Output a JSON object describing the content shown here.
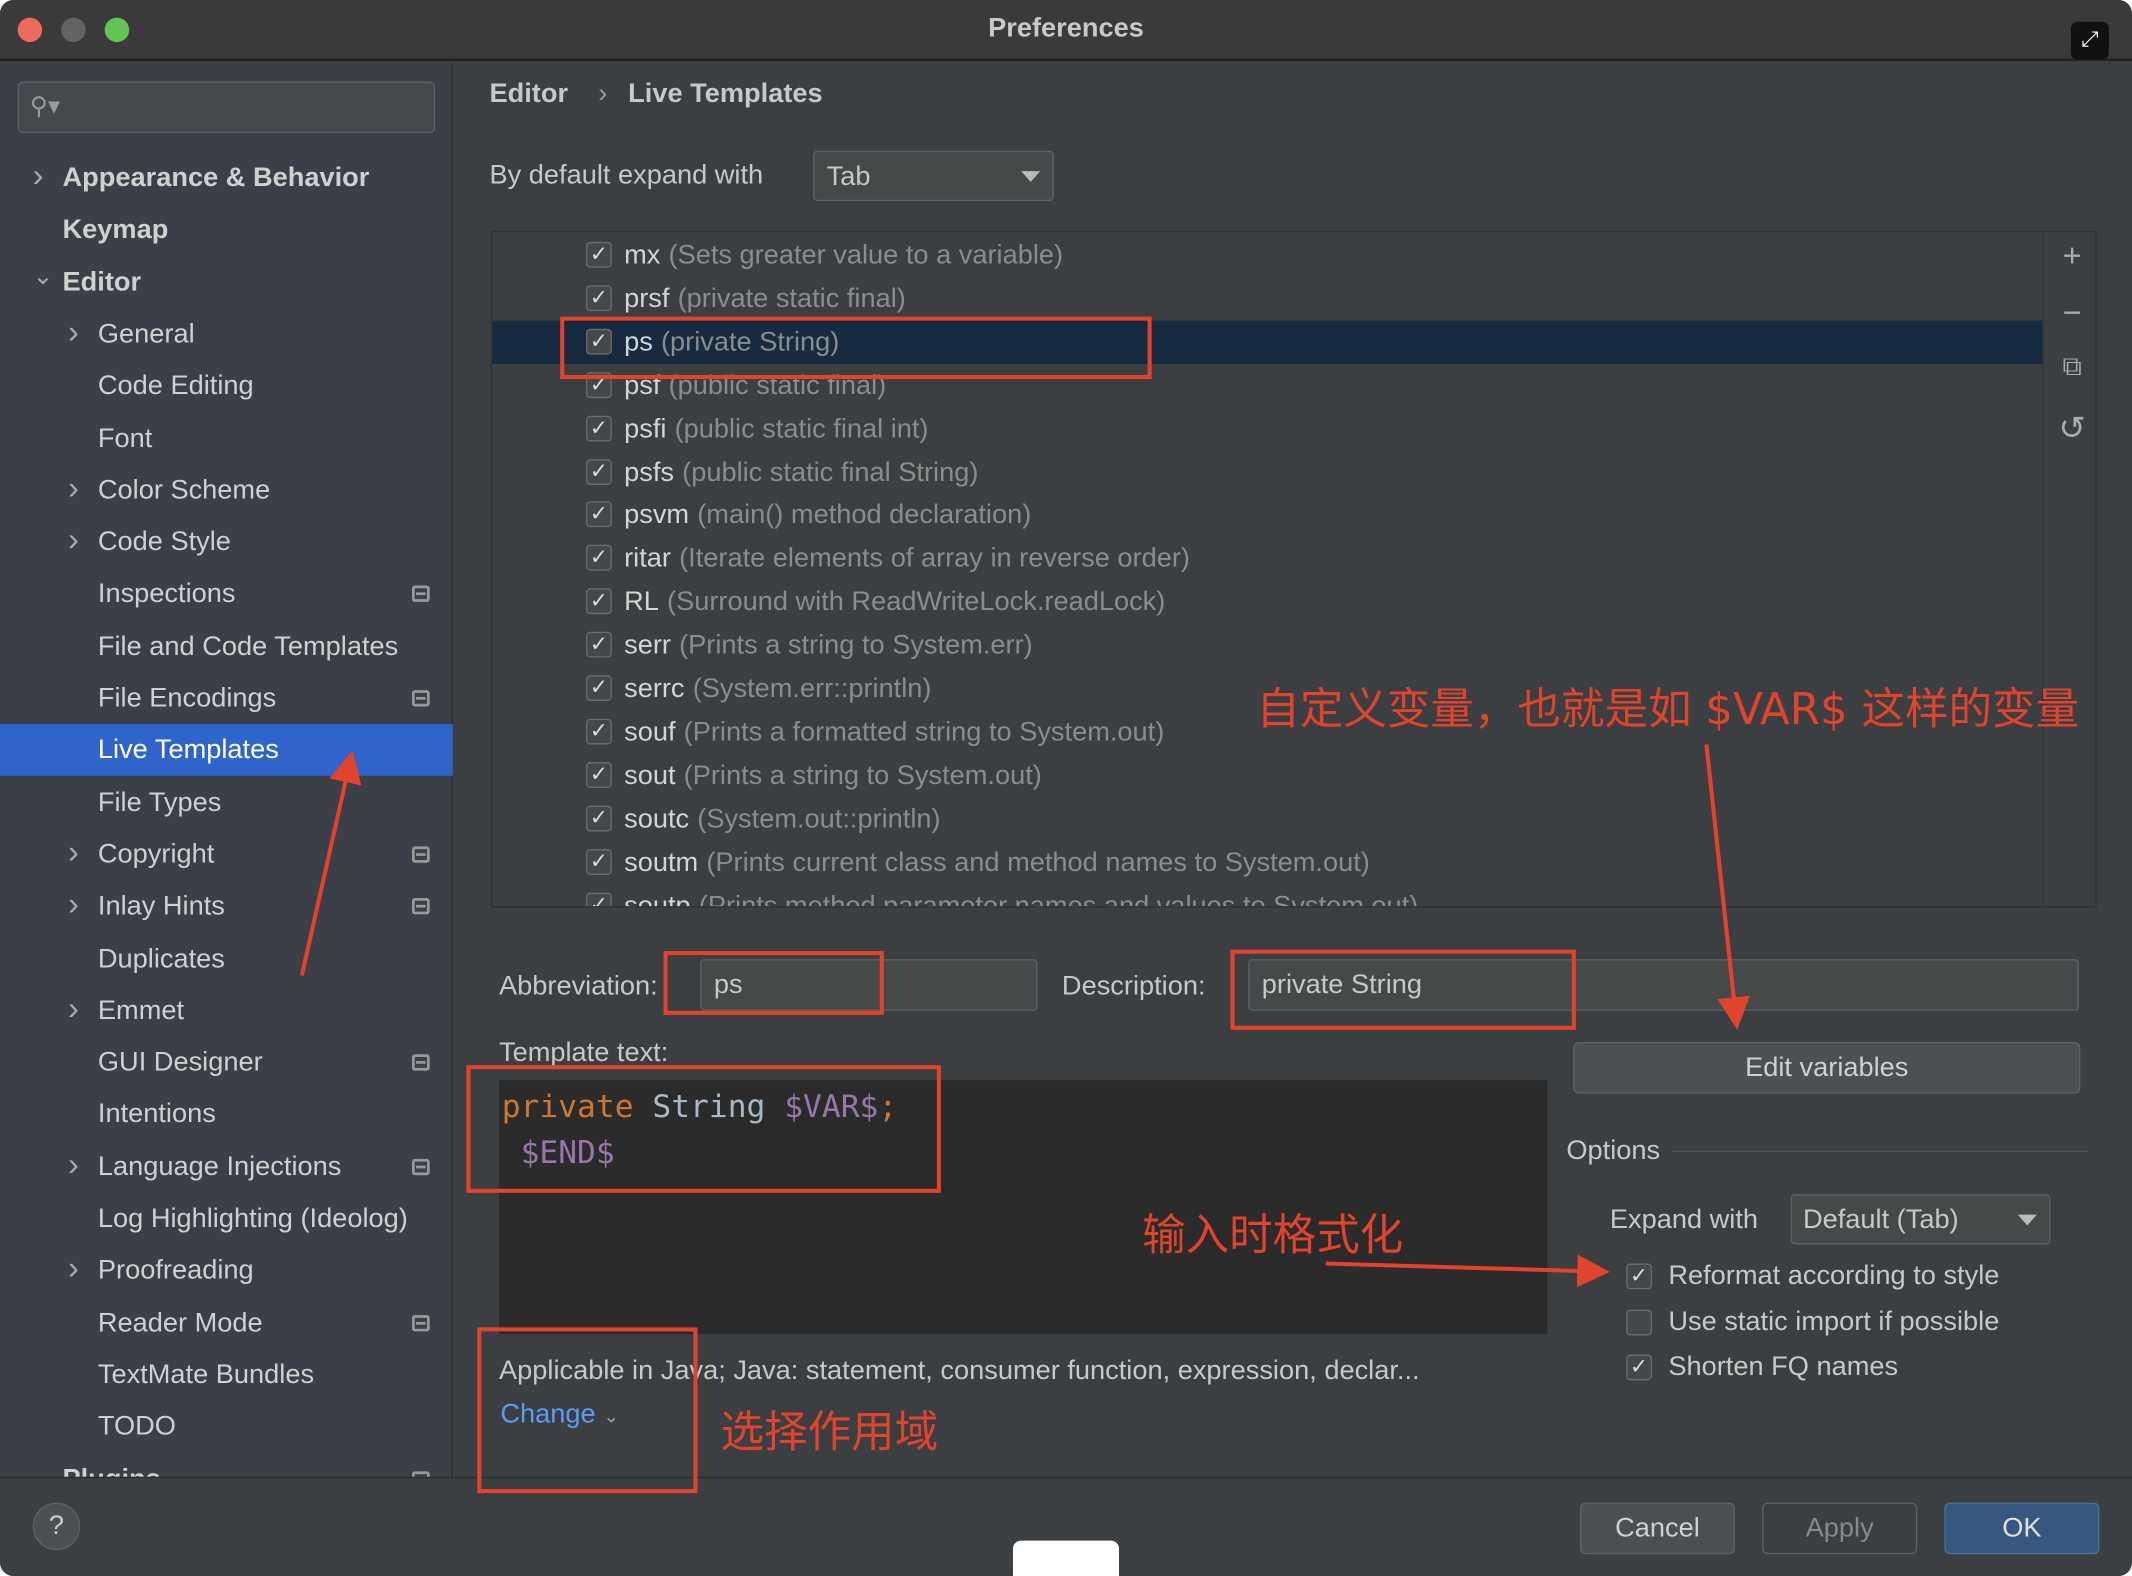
{
  "window": {
    "title": "Preferences"
  },
  "sidebar": {
    "search_placeholder": "",
    "items": [
      {
        "label": "Appearance & Behavior",
        "level": 0,
        "chevron": "right",
        "bold": true
      },
      {
        "label": "Keymap",
        "level": 0,
        "bold": true
      },
      {
        "label": "Editor",
        "level": 0,
        "chevron": "down",
        "bold": true
      },
      {
        "label": "General",
        "level": 1,
        "chevron": "right"
      },
      {
        "label": "Code Editing",
        "level": 1
      },
      {
        "label": "Font",
        "level": 1
      },
      {
        "label": "Color Scheme",
        "level": 1,
        "chevron": "right"
      },
      {
        "label": "Code Style",
        "level": 1,
        "chevron": "right"
      },
      {
        "label": "Inspections",
        "level": 1,
        "settings": true
      },
      {
        "label": "File and Code Templates",
        "level": 1
      },
      {
        "label": "File Encodings",
        "level": 1,
        "settings": true
      },
      {
        "label": "Live Templates",
        "level": 1,
        "selected": true
      },
      {
        "label": "File Types",
        "level": 1
      },
      {
        "label": "Copyright",
        "level": 1,
        "chevron": "right",
        "settings": true
      },
      {
        "label": "Inlay Hints",
        "level": 1,
        "chevron": "right",
        "settings": true
      },
      {
        "label": "Duplicates",
        "level": 1
      },
      {
        "label": "Emmet",
        "level": 1,
        "chevron": "right"
      },
      {
        "label": "GUI Designer",
        "level": 1,
        "settings": true
      },
      {
        "label": "Intentions",
        "level": 1
      },
      {
        "label": "Language Injections",
        "level": 1,
        "chevron": "right",
        "settings": true
      },
      {
        "label": "Log Highlighting (Ideolog)",
        "level": 1
      },
      {
        "label": "Proofreading",
        "level": 1,
        "chevron": "right"
      },
      {
        "label": "Reader Mode",
        "level": 1,
        "settings": true
      },
      {
        "label": "TextMate Bundles",
        "level": 1
      },
      {
        "label": "TODO",
        "level": 1
      },
      {
        "label": "Plugins",
        "level": 0,
        "bold": true,
        "settings": true
      }
    ]
  },
  "breadcrumb": {
    "parent": "Editor",
    "separator": "›",
    "current": "Live Templates"
  },
  "expand": {
    "label": "By default expand with",
    "value": "Tab"
  },
  "templates": [
    {
      "abbr": "mx",
      "desc": "(Sets greater value to a variable)",
      "checked": true
    },
    {
      "abbr": "prsf",
      "desc": "(private static final)",
      "checked": true
    },
    {
      "abbr": "ps",
      "desc": "(private String)",
      "checked": true,
      "selected": true
    },
    {
      "abbr": "psf",
      "desc": "(public static final)",
      "checked": true
    },
    {
      "abbr": "psfi",
      "desc": "(public static final int)",
      "checked": true
    },
    {
      "abbr": "psfs",
      "desc": "(public static final String)",
      "checked": true
    },
    {
      "abbr": "psvm",
      "desc": "(main() method declaration)",
      "checked": true
    },
    {
      "abbr": "ritar",
      "desc": "(Iterate elements of array in reverse order)",
      "checked": true
    },
    {
      "abbr": "RL",
      "desc": "(Surround with ReadWriteLock.readLock)",
      "checked": true
    },
    {
      "abbr": "serr",
      "desc": "(Prints a string to System.err)",
      "checked": true
    },
    {
      "abbr": "serrc",
      "desc": "(System.err::println)",
      "checked": true
    },
    {
      "abbr": "souf",
      "desc": "(Prints a formatted string to System.out)",
      "checked": true
    },
    {
      "abbr": "sout",
      "desc": "(Prints a string to System.out)",
      "checked": true
    },
    {
      "abbr": "soutc",
      "desc": "(System.out::println)",
      "checked": true
    },
    {
      "abbr": "soutm",
      "desc": "(Prints current class and method names to System.out)",
      "checked": true
    },
    {
      "abbr": "soutp",
      "desc": "(Prints method parameter names and values to System.out)",
      "checked": true
    }
  ],
  "tools": {
    "add": "+",
    "remove": "−",
    "copy": "⧉",
    "restore": "↺"
  },
  "detail": {
    "abbreviation_label": "Abbreviation:",
    "abbreviation": "ps",
    "description_label": "Description:",
    "description": "private String",
    "template_text_label": "Template text:",
    "code": {
      "kw": "private",
      "type": "String",
      "var": "$VAR$",
      "semi": ";",
      "end": "$END$"
    },
    "edit_variables": "Edit variables",
    "applicable": "Applicable in Java; Java: statement, consumer function, expression, declar...",
    "change": "Change"
  },
  "options": {
    "title": "Options",
    "expand_label": "Expand with",
    "expand_value": "Default (Tab)",
    "checks": [
      {
        "label": "Reformat according to style",
        "checked": true
      },
      {
        "label": "Use static import if possible",
        "checked": false
      },
      {
        "label": "Shorten FQ names",
        "checked": true
      }
    ]
  },
  "annotations": {
    "variables": "自定义变量，也就是如 $VAR$ 这样的变量",
    "reformat": "输入时格式化",
    "scope": "选择作用域"
  },
  "footer": {
    "help": "?",
    "cancel": "Cancel",
    "apply": "Apply",
    "ok": "OK"
  },
  "colors": {
    "accent": "#2f65ca",
    "annotation": "#e1432c",
    "link": "#589df6"
  }
}
